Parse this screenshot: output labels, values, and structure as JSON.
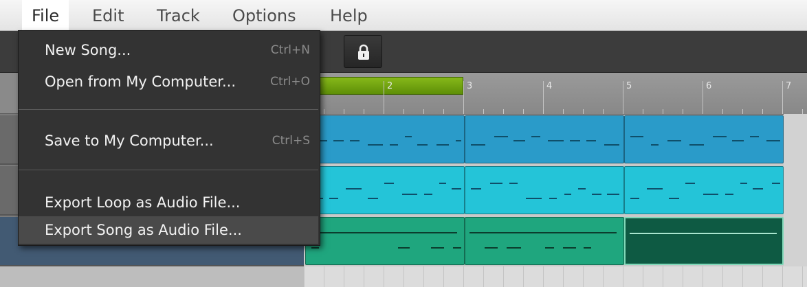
{
  "menubar": {
    "items": [
      {
        "label": "File"
      },
      {
        "label": "Edit"
      },
      {
        "label": "Track"
      },
      {
        "label": "Options"
      },
      {
        "label": "Help"
      }
    ]
  },
  "file_menu": {
    "items": [
      {
        "label": "New Song...",
        "shortcut": "Ctrl+N"
      },
      {
        "label": "Open from My Computer...",
        "shortcut": "Ctrl+O"
      },
      {
        "label": "Save to My Computer...",
        "shortcut": "Ctrl+S"
      },
      {
        "label": "Export Loop as Audio File...",
        "shortcut": ""
      },
      {
        "label": "Export Song as Audio File...",
        "shortcut": ""
      }
    ]
  },
  "toolbar": {
    "lock_icon": "lock-icon"
  },
  "timeline": {
    "bar_numbers": [
      "2",
      "3",
      "4",
      "5",
      "6",
      "7"
    ]
  },
  "colors": {
    "loop_region": "#6fa10f",
    "track1_clip": "#2a9bc9",
    "track2_clip": "#24c4d8",
    "track3_clip": "#1fa67e",
    "track3_clip_selected": "#0e5a43",
    "menu_bg": "#333333"
  }
}
